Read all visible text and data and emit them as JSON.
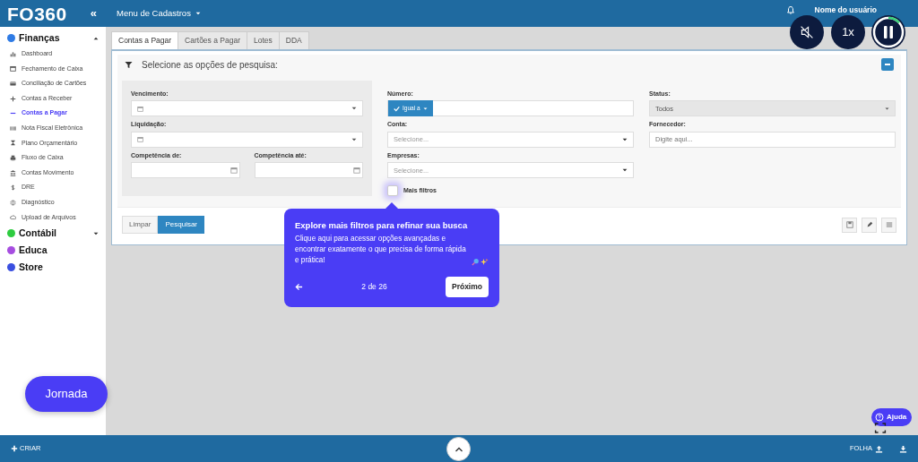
{
  "sidebar": {
    "logo": "FO360",
    "collapse": "«",
    "sections": [
      {
        "label": "Finanças",
        "kind": "group",
        "expanded": true,
        "color": "#2f7be5",
        "items": [
          {
            "label": "Dashboard",
            "selected": false
          },
          {
            "label": "Fechamento de Caixa",
            "selected": false
          },
          {
            "label": "Conciliação de Cartões",
            "selected": false
          },
          {
            "label": "Contas a Receber",
            "selected": false
          },
          {
            "label": "Contas a Pagar",
            "selected": true
          },
          {
            "label": "Nota Fiscal Eletrônica",
            "selected": false
          },
          {
            "label": "Plano Orçamentário",
            "selected": false
          },
          {
            "label": "Fluxo de Caixa",
            "selected": false
          },
          {
            "label": "Contas Movimento",
            "selected": false
          },
          {
            "label": "DRE",
            "selected": false
          },
          {
            "label": "Diagnóstico",
            "selected": false
          },
          {
            "label": "Upload de Arquivos",
            "selected": false
          }
        ]
      },
      {
        "label": "Contábil",
        "kind": "group",
        "expanded": false,
        "color": "#2ecc40"
      },
      {
        "label": "Educa",
        "kind": "link",
        "color": "#a64de0"
      },
      {
        "label": "Store",
        "kind": "link",
        "color": "#3a4fe0"
      }
    ]
  },
  "navbar": {
    "menu": "Menu de Cadastros",
    "user": "Nome do usuário"
  },
  "player": {
    "speed": "1x",
    "muted": true
  },
  "tabs": [
    {
      "label": "Contas a Pagar",
      "selected": true
    },
    {
      "label": "Cartões a Pagar",
      "selected": false
    },
    {
      "label": "Lotes",
      "selected": false
    },
    {
      "label": "DDA",
      "selected": false
    }
  ],
  "panel": {
    "title": "Selecione as opções de pesquisa:",
    "left": [
      {
        "label": "Vencimento:",
        "kind": "date-select"
      },
      {
        "label": "Liquidação:",
        "kind": "date-select"
      },
      {
        "label": "Competência de:",
        "kind": "date"
      },
      {
        "label": "Competência até:",
        "kind": "date"
      }
    ],
    "middle": [
      {
        "label": "Número:",
        "kind": "operator",
        "operator": "Igual a"
      },
      {
        "label": "Conta:",
        "kind": "select",
        "placeholder": "Selecione..."
      },
      {
        "label": "Empresas:",
        "kind": "select",
        "placeholder": "Selecione..."
      }
    ],
    "more_filters": {
      "label": "Mais filtros",
      "checked": false
    },
    "right": [
      {
        "label": "Status:",
        "kind": "select-filled",
        "value": "Todos"
      },
      {
        "label": "Fornecedor:",
        "kind": "text",
        "placeholder": "Digite aqui..."
      }
    ],
    "buttons": [
      {
        "label": "Limpar",
        "kind": "secondary"
      },
      {
        "label": "Pesquisar",
        "kind": "primary"
      }
    ]
  },
  "tour": {
    "title": "Explore mais filtros para refinar sua busca",
    "body": "Clique aqui para acessar opções avançadas e encontrar exatamente o que precisa de forma rápida e prática!",
    "step": "2 de 26",
    "next": "Próximo"
  },
  "journey_button": "Jornada",
  "help_button": "Ajuda",
  "bottom_bar": {
    "create": "CRIAR",
    "sheet": "FOLHA"
  }
}
